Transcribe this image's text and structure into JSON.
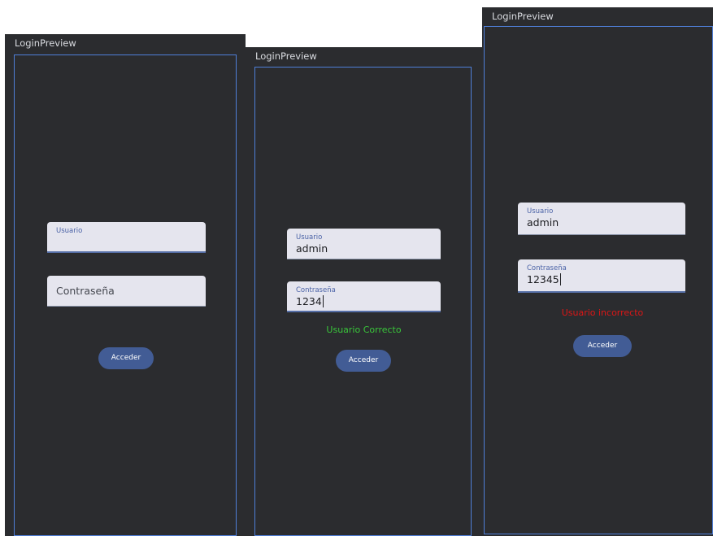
{
  "colors": {
    "panel_bg": "#2b2c2f",
    "frame_border": "#4f7fd8",
    "field_bg": "#e5e5ee",
    "label_accent": "#4b63a7",
    "button_bg": "#425c95",
    "success": "#39c53a",
    "error": "#dd1616"
  },
  "panels": [
    {
      "title": "LoginPreview",
      "username": {
        "label": "Usuario",
        "value": ""
      },
      "password": {
        "placeholder": "Contraseña"
      },
      "button_label": "Acceder",
      "status": ""
    },
    {
      "title": "LoginPreview",
      "username": {
        "label": "Usuario",
        "value": "admin"
      },
      "password": {
        "label": "Contraseña",
        "value": "1234"
      },
      "button_label": "Acceder",
      "status": "Usuario Correcto"
    },
    {
      "title": "LoginPreview",
      "username": {
        "label": "Usuario",
        "value": "admin"
      },
      "password": {
        "label": "Contraseña",
        "value": "12345"
      },
      "button_label": "Acceder",
      "status": "Usuario incorrecto"
    }
  ]
}
